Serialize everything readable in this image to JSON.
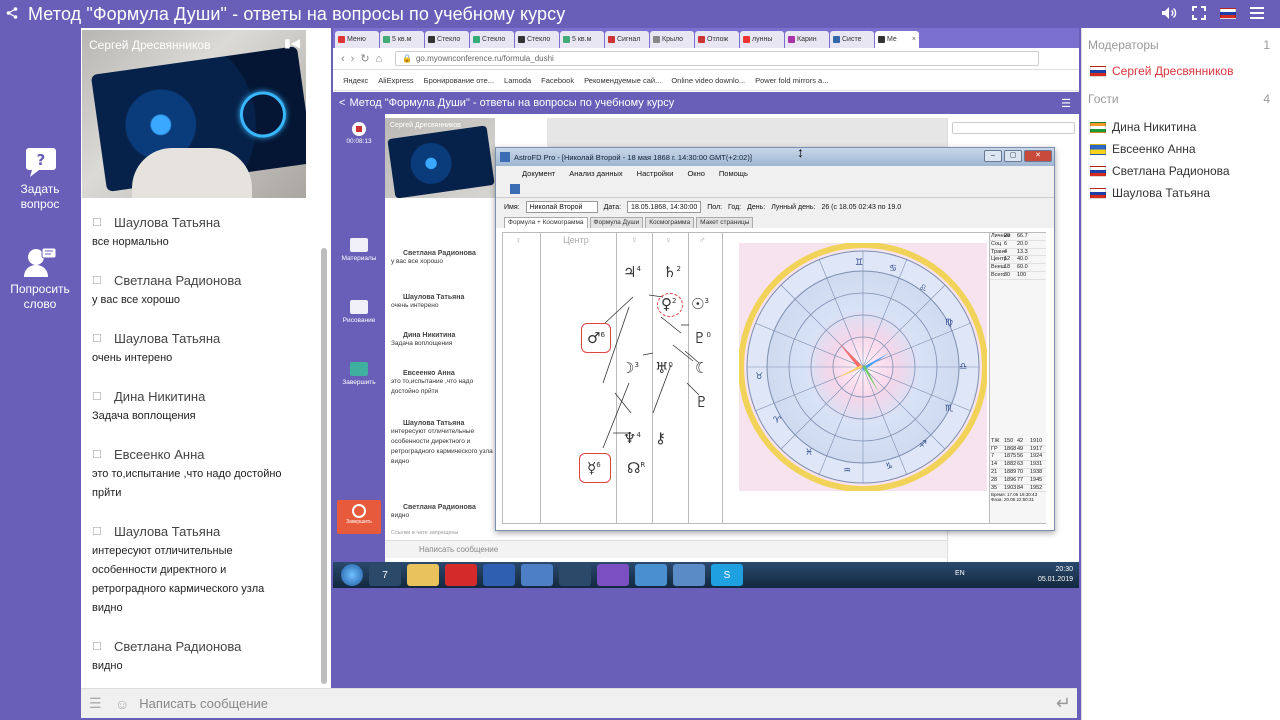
{
  "header": {
    "title": "Метод \"Формула Души\" - ответы на вопросы по учебному курсу"
  },
  "rail": {
    "ask_label": "Задать вопрос",
    "speak_label": "Попросить слово"
  },
  "video": {
    "name": "Сергей Дресвянников"
  },
  "messages": [
    {
      "name": "Шаулова Татьяна",
      "text": "все нормально"
    },
    {
      "name": "Светлана Радионова",
      "text": "у вас все хорошо"
    },
    {
      "name": "Шаулова Татьяна",
      "text": "очень интерено"
    },
    {
      "name": "Дина Никитина",
      "text": "Задача воплощения"
    },
    {
      "name": "Евсеенко Анна",
      "text": "это то,испытание ,что надо достойно прйти"
    },
    {
      "name": "Шаулова Татьяна",
      "text": "интересуют отличительные особенности директного и ретроградного кармического узла видно"
    },
    {
      "name": "Светлана Радионова",
      "text": "видно"
    }
  ],
  "chat_input": {
    "placeholder": "Написать сообщение"
  },
  "users": {
    "moderators_label": "Модераторы",
    "moderators_count": "1",
    "guests_label": "Гости",
    "guests_count": "4",
    "moderators": [
      {
        "name": "Сергей Дресвянников"
      }
    ],
    "guests": [
      {
        "name": "Дина Никитина",
        "flag": "in"
      },
      {
        "name": "Евсеенко Анна",
        "flag": "ua"
      },
      {
        "name": "Светлана Радионова",
        "flag": "ru"
      },
      {
        "name": "Шаулова Татьяна",
        "flag": "ru"
      }
    ]
  },
  "browser": {
    "tabs": [
      "Меню",
      "5 кв.м",
      "Стекло",
      "Стекло",
      "Стекло",
      "5 кв.м",
      "Сигнал",
      "Крыло",
      "Отлож",
      "лунны",
      "Карин",
      "Систе",
      "Ме"
    ],
    "url": "go.myownconference.ru/formula_dushi",
    "bookmarks": [
      "Яндекс",
      "AliExpress",
      "Бронирование оте...",
      "Lamoda",
      "Facebook",
      "Рекомендуемые сай...",
      "Online video downlo...",
      "Power fold mirrors a..."
    ]
  },
  "inner": {
    "title": "Метод \"Формула Души\" - ответы на вопросы по учебному курсу",
    "presenter": "Сергей Дресвянников",
    "timer": "00:08:13",
    "rail": [
      "Материалы",
      "Рисование",
      "Завершить"
    ],
    "rec_label": "Завершить",
    "messages": [
      {
        "name": "Светлана Радионова",
        "text": "у вас все хорошо"
      },
      {
        "name": "Шаулова Татьяна",
        "text": "очень интерено"
      },
      {
        "name": "Дина Никитина",
        "text": "Задача воплощения"
      },
      {
        "name": "Евсеенко Анна",
        "text": "это то,испытание ,что надо достойно прйти"
      },
      {
        "name": "Шаулова Татьяна",
        "text": "интересуют отличительные особенности директного и ретроградного кармического узла видно"
      },
      {
        "name": "Светлана Радионова",
        "text": "видно"
      }
    ],
    "input_placeholder": "Написать сообщение",
    "links_note": "Ссылки в чате запрещены"
  },
  "astro": {
    "title": "AstroFD Pro - [Николай Второй - 18 мая 1868 г. 14:30:00 GMT(+2:02)]",
    "menu": [
      "Документ",
      "Анализ данных",
      "Настройки",
      "Окно",
      "Помощь"
    ],
    "name_label": "Имя:",
    "name_value": "Николай Второй",
    "date_label": "Дата:",
    "date_value": "18.05.1868, 14:30:00",
    "pol_label": "Пол:",
    "god_label": "Год:",
    "den_label": "День:",
    "lunar_label": "Лунный день:",
    "lunar_value": "26 (с 18.05 02:43 по 19.0",
    "tabs": [
      "Формула + Космограмма",
      "Формула Души",
      "Космограмма",
      "Макет страницы"
    ],
    "col_header": "Центр",
    "stats_rows": [
      [
        "Личные",
        "20",
        "66.7"
      ],
      [
        "Соц",
        "6",
        "20.0"
      ],
      [
        "Транс",
        "4",
        "13.3"
      ],
      [
        "Центр",
        "12",
        "40.0"
      ],
      [
        "Внеш",
        "18",
        "60.0"
      ],
      [
        "Всего",
        "30",
        "100"
      ]
    ],
    "bottom_rows": [
      [
        "ТЖ",
        "150",
        "42",
        "1910"
      ],
      [
        "ГР",
        "1868",
        "49",
        "1917"
      ],
      [
        "7",
        "1875",
        "56",
        "1924"
      ],
      [
        "14",
        "1882",
        "63",
        "1931"
      ],
      [
        "21",
        "1889",
        "70",
        "1938"
      ],
      [
        "28",
        "1896",
        "77",
        "1945"
      ],
      [
        "35",
        "1903",
        "84",
        "1952"
      ]
    ],
    "time_label": "Время: 17.05 18:30:43",
    "phase_label": "Фаза: 20.05 22:50:31"
  },
  "taskbar": {
    "lang": "EN",
    "time": "20:30",
    "date": "05.01.2019"
  },
  "colors": {
    "brand": "#6a5fb8",
    "moderator": "#d9363e"
  }
}
